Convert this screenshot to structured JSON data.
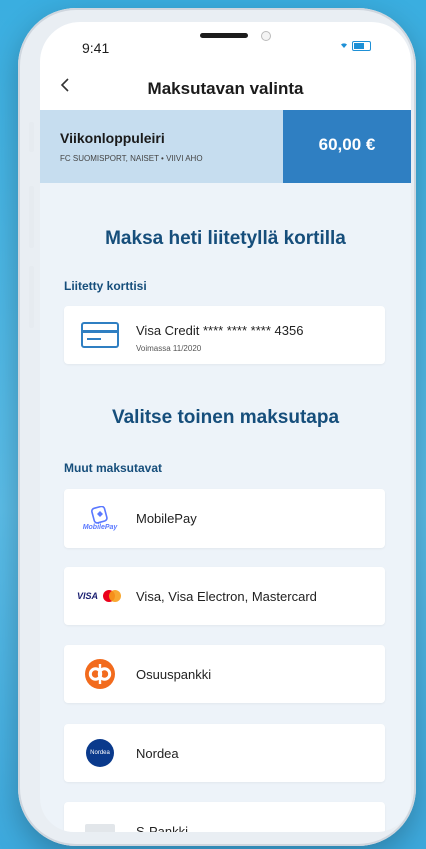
{
  "status": {
    "time": "9:41"
  },
  "nav": {
    "title": "Maksutavan valinta",
    "back_icon": "chevron-left-icon"
  },
  "event": {
    "name": "Viikonloppuleiri",
    "subtitle": "FC SUOMISPORT, NAISET • VIIVI AHO",
    "price": "60,00 €"
  },
  "saved": {
    "heading": "Maksa heti liitetyllä kortilla",
    "section_label": "Liitetty korttisi",
    "card_number": "Visa Credit **** **** **** 4356",
    "card_valid": "Voimassa 11/2020"
  },
  "other": {
    "heading": "Valitse toinen maksutapa",
    "section_label": "Muut maksutavat",
    "methods": [
      {
        "label": "MobilePay",
        "logo_text": "MobilePay",
        "icon": "mobilepay-logo-icon"
      },
      {
        "label": "Visa, Visa Electron, Mastercard",
        "logo_text": "VISA",
        "icon": "visa-mastercard-logo-icon"
      },
      {
        "label": "Osuuspankki",
        "icon": "op-logo-icon"
      },
      {
        "label": "Nordea",
        "logo_text": "Nordea",
        "icon": "nordea-logo-icon"
      },
      {
        "label": "S-Pankki",
        "icon": "s-pankki-logo-icon"
      }
    ]
  },
  "colors": {
    "brand_dark": "#164e7b",
    "brand_blue": "#2f7fc2",
    "event_bg": "#c6ddef",
    "op_orange": "#f26b1d",
    "nordea_blue": "#0a3a8c"
  }
}
